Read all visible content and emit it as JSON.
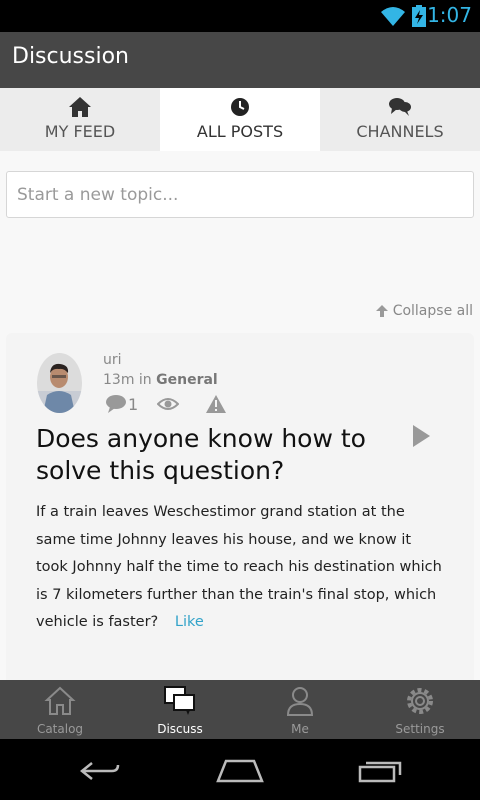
{
  "status_bar": {
    "time": "1:07",
    "accent_color": "#33b5e5",
    "icons": [
      "wifi-icon",
      "battery-charging-icon"
    ]
  },
  "action_bar": {
    "title": "Discussion"
  },
  "tabs": [
    {
      "label": "MY FEED",
      "icon": "home-icon",
      "active": false
    },
    {
      "label": "ALL POSTS",
      "icon": "clock-icon",
      "active": true
    },
    {
      "label": "CHANNELS",
      "icon": "chat-bubbles-icon",
      "active": false
    }
  ],
  "new_topic": {
    "placeholder": "Start a new topic..."
  },
  "collapse_all": {
    "label": "Collapse all",
    "icon": "arrow-up-icon"
  },
  "post": {
    "author": "uri",
    "time": "13m in",
    "channel": "General",
    "comment_count": "1",
    "title": "Does anyone know how to solve this question?",
    "body": "If a train leaves Weschestimor grand station at the same time Johnny leaves his house, and we know it took Johnny half the time to reach his destination which is 7 kilometers further than the train's final stop, which vehicle is faster?",
    "like_label": "Like",
    "link_color": "#33a3c9"
  },
  "bottom_nav": [
    {
      "label": "Catalog",
      "icon": "house-outline-icon",
      "active": false
    },
    {
      "label": "Discuss",
      "icon": "discuss-bubbles-icon",
      "active": true
    },
    {
      "label": "Me",
      "icon": "person-icon",
      "active": false
    },
    {
      "label": "Settings",
      "icon": "gear-icon",
      "active": false
    }
  ],
  "system_nav": {
    "icons": [
      "back-icon",
      "home-icon",
      "recent-apps-icon"
    ]
  }
}
